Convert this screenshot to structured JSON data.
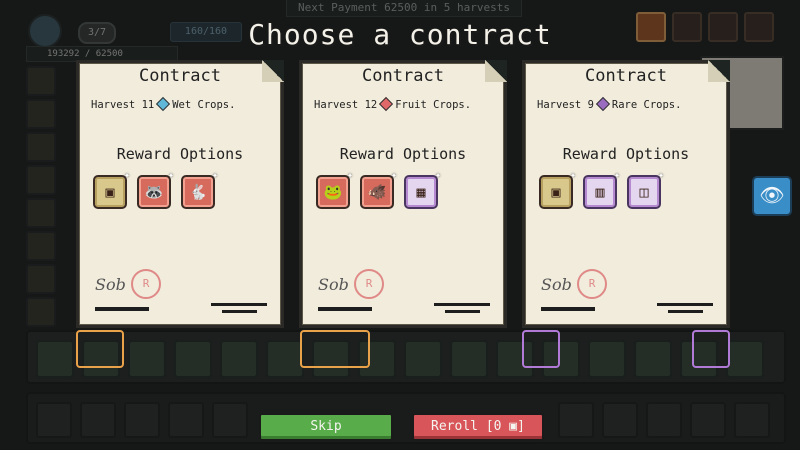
{
  "hud": {
    "next_payment": "Next Payment 62500 in 5 harvests",
    "level": "3/7",
    "energy": "160/160",
    "money": "193292 / 62500"
  },
  "overlay": {
    "title": "Choose a contract",
    "contracts": [
      {
        "heading": "Contract",
        "requirement_prefix": "Harvest 11",
        "requirement_suffix": "Wet Crops.",
        "gem_color": "#5fb8d8",
        "rewards_heading": "Reward Options",
        "rewards": [
          {
            "icon": "upgrade-scroll-icon",
            "glyph": "▣",
            "style": "yellow"
          },
          {
            "icon": "raccoon-icon",
            "glyph": "🦝",
            "style": "red"
          },
          {
            "icon": "rabbit-icon",
            "glyph": "🐇",
            "style": "red"
          }
        ],
        "stamp": "R"
      },
      {
        "heading": "Contract",
        "requirement_prefix": "Harvest 12",
        "requirement_suffix": "Fruit Crops.",
        "gem_color": "#e06868",
        "rewards_heading": "Reward Options",
        "rewards": [
          {
            "icon": "frog-icon",
            "glyph": "🐸",
            "style": "green"
          },
          {
            "icon": "boar-icon",
            "glyph": "🐗",
            "style": "red"
          },
          {
            "icon": "card-pack-icon",
            "glyph": "▦",
            "style": "purple"
          }
        ],
        "stamp": "R"
      },
      {
        "heading": "Contract",
        "requirement_prefix": "Harvest 9",
        "requirement_suffix": "Rare Crops.",
        "gem_color": "#9a6cc0",
        "rewards_heading": "Reward Options",
        "rewards": [
          {
            "icon": "upgrade-scroll-icon",
            "glyph": "▣",
            "style": "yellow"
          },
          {
            "icon": "basket-icon",
            "glyph": "▥",
            "style": "purple"
          },
          {
            "icon": "seed-packet-icon",
            "glyph": "◫",
            "style": "purple"
          }
        ],
        "stamp": "R"
      }
    ],
    "skip_label": "Skip",
    "reroll_label": "Reroll [0 ▣]"
  }
}
